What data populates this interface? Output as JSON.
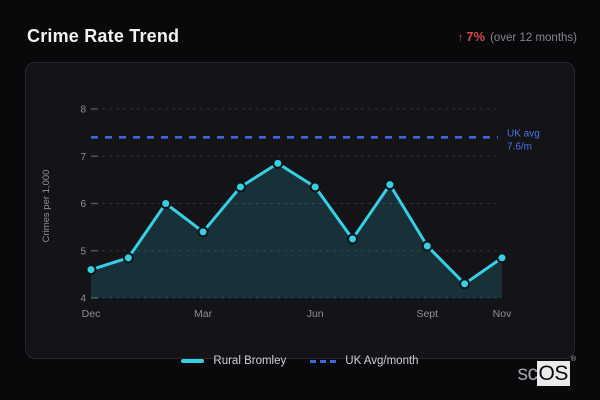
{
  "header": {
    "title": "Crime Rate Trend",
    "trend_arrow": "↑",
    "trend_percent": "7%",
    "trend_note": "(over 12 months)"
  },
  "chart_data": {
    "type": "line",
    "title": "Crime Rate Trend",
    "xlabel": "",
    "ylabel": "Crimes per 1,000",
    "ylim": [
      4,
      8
    ],
    "yticks": [
      4,
      5,
      6,
      7,
      8
    ],
    "grid": "dashed-horizontal",
    "legend_position": "bottom",
    "x_tick_labels": [
      {
        "label": "Dec",
        "index": 0
      },
      {
        "label": "Mar",
        "index": 3
      },
      {
        "label": "Jun",
        "index": 6
      },
      {
        "label": "Sept",
        "index": 9
      },
      {
        "label": "Nov",
        "index": 11
      }
    ],
    "series": [
      {
        "name": "Rural Bromley",
        "type": "line+area+points",
        "color": "#36cfe3",
        "values": [
          4.6,
          4.85,
          6.0,
          5.4,
          6.35,
          6.85,
          6.35,
          5.25,
          6.4,
          5.1,
          4.3,
          4.85
        ]
      },
      {
        "name": "UK Avg/month",
        "type": "dashed-reference-line",
        "color": "#3d68da",
        "y": 7.4,
        "annotation_line1": "UK avg",
        "annotation_line2": "7.6/m"
      }
    ]
  },
  "legend": {
    "items": [
      {
        "label": "Rural Bromley",
        "style": "solid-cyan"
      },
      {
        "label": "UK Avg/month",
        "style": "dashed-blue"
      }
    ]
  },
  "logo": {
    "prefix": "sc",
    "suffix": "OS",
    "reg": "®"
  },
  "colors": {
    "page_bg": "#09090b",
    "card_bg": "#131318",
    "card_border": "#26262c",
    "series_cyan": "#36cfe3",
    "reference_blue": "#3d68da",
    "reference_label_blue": "#4b77e0",
    "trend_red": "#d34b4b",
    "title_text": "#f1f1f3",
    "muted_text": "#8f9096",
    "legend_text": "#cfd1d5",
    "grid_line": "#2f2f36",
    "tick_mark": "#55565e",
    "area_fill": "rgba(54,207,227,0.16)",
    "point_ring": "#10151a"
  }
}
